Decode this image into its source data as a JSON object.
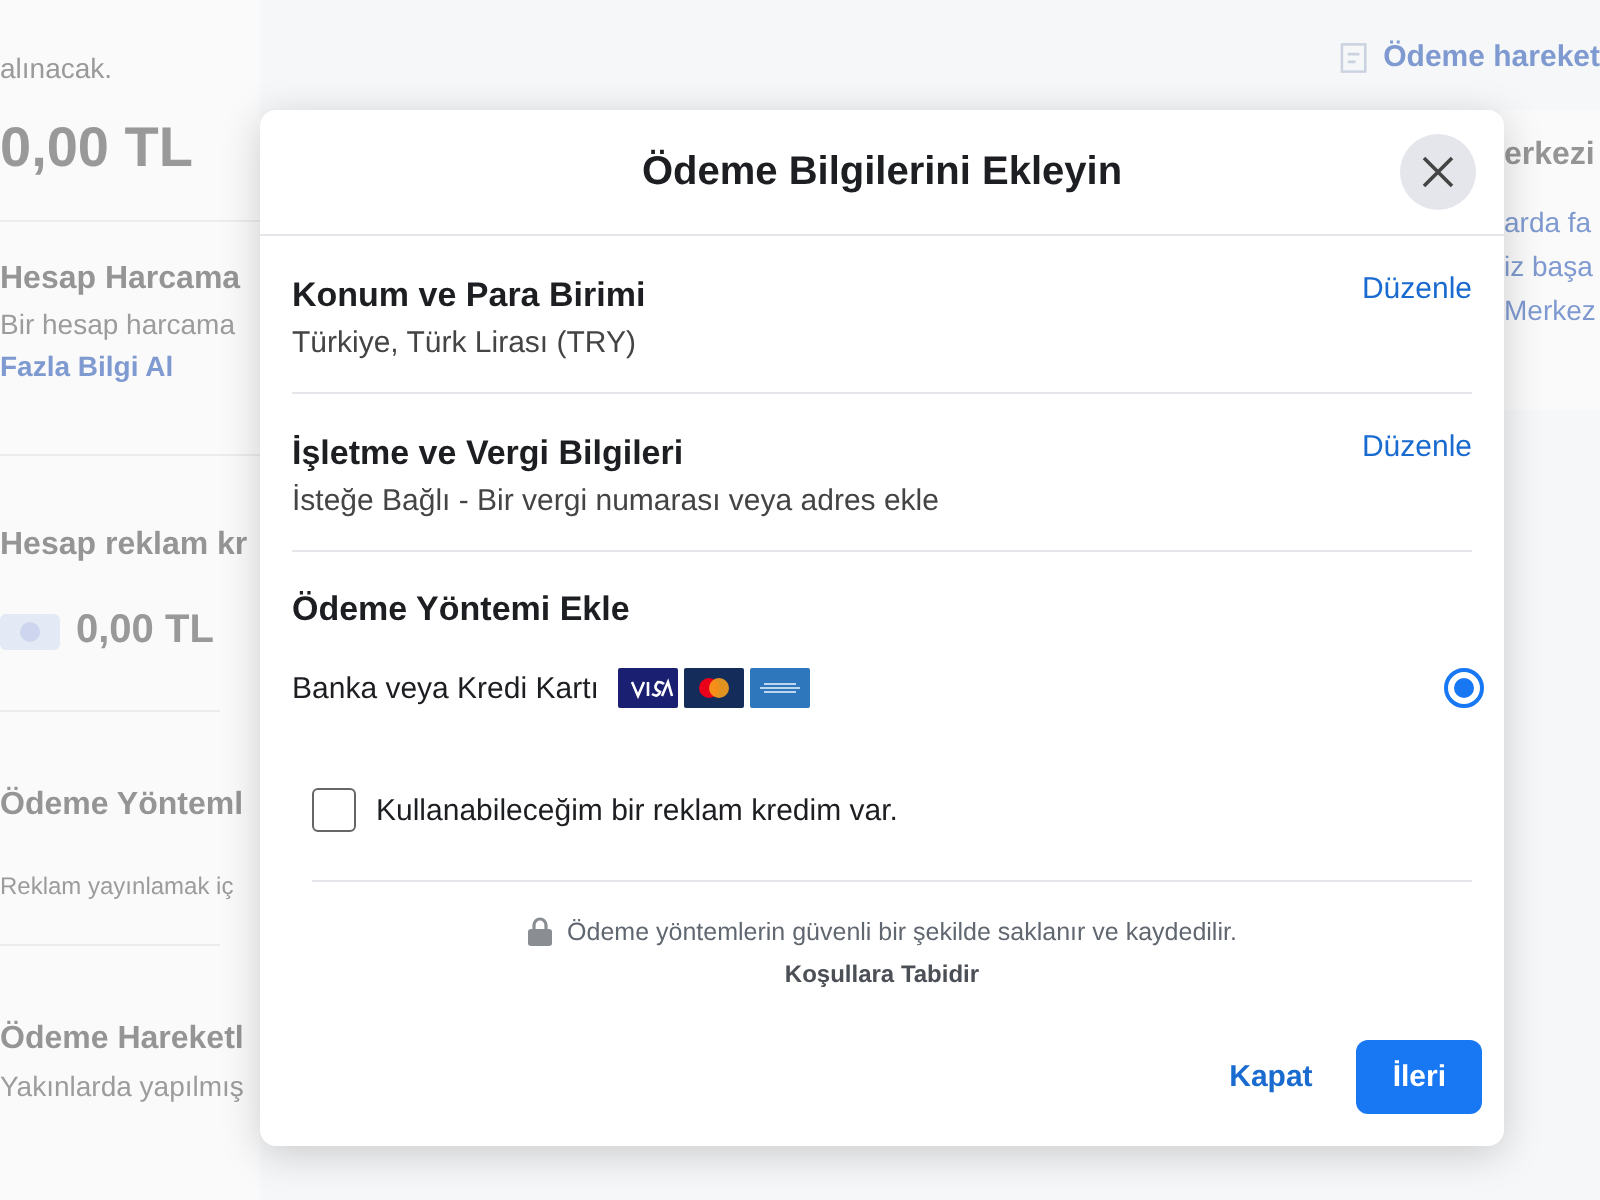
{
  "background": {
    "left": {
      "note": "alınacak.",
      "balance": "0,00 TL",
      "spending_limit": {
        "title": "Hesap Harcama",
        "text": "Bir hesap harcama",
        "link": "Fazla Bilgi Al"
      },
      "ad_credit": {
        "title": "Hesap reklam kr",
        "amount": "0,00 TL"
      },
      "payment_methods": {
        "title": "Ödeme Yönteml",
        "text": "Reklam yayınlamak iç"
      },
      "payment_activity": {
        "title": "Ödeme Hareketl",
        "text": "Yakınlarda yapılmış"
      }
    },
    "right": {
      "activity_link": "Ödeme hareket",
      "help": {
        "title": "erkezi",
        "lines": [
          "arda fa",
          "iz başa",
          "Merkez"
        ]
      }
    }
  },
  "modal": {
    "title": "Ödeme Bilgilerini Ekleyin",
    "sections": [
      {
        "title": "Konum ve Para Birimi",
        "value": "Türkiye, Türk Lirası (TRY)",
        "action": "Düzenle"
      },
      {
        "title": "İşletme ve Vergi Bilgileri",
        "value": "İsteğe Bağlı - Bir vergi numarası veya adres ekle",
        "action": "Düzenle"
      }
    ],
    "payment": {
      "title": "Ödeme Yöntemi Ekle",
      "options": [
        {
          "label": "Banka veya Kredi Kartı",
          "selected": true
        }
      ]
    },
    "credit": {
      "label": "Kullanabileceğim bir reklam kredim var.",
      "checked": false
    },
    "footer": {
      "note": "Ödeme yöntemlerin güvenli bir şekilde saklanır ve kaydedilir.",
      "terms": "Koşullara Tabidir"
    },
    "buttons": [
      {
        "label": "Kapat",
        "kind": "secondary"
      },
      {
        "label": "İleri",
        "kind": "primary"
      }
    ]
  }
}
